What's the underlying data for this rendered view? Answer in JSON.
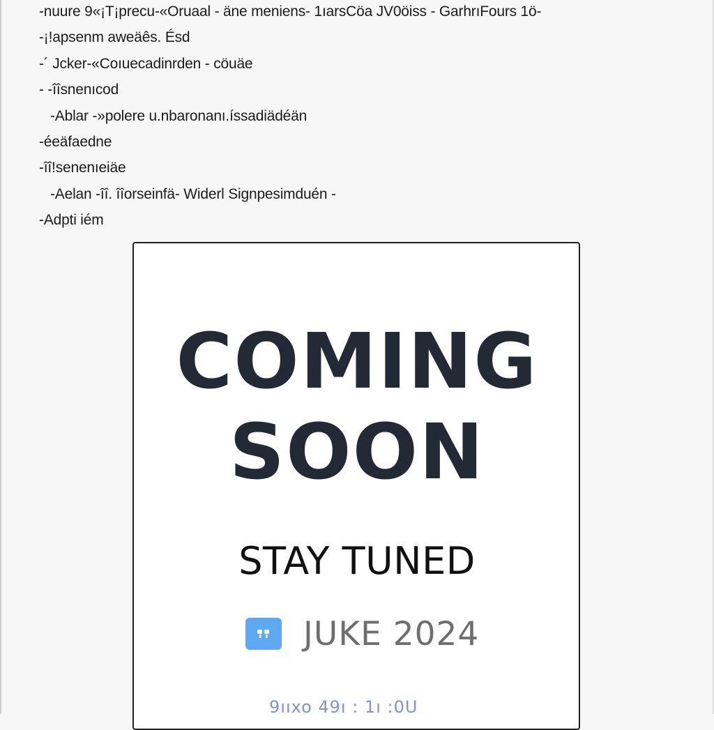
{
  "text_lines": [
    "-nuure 9«¡T¡precu-«Oruaal - äne meniens- 1ıarsCöa JV0öiss - GarhrıFours 1ö-",
    "-¡!apsenm aweäês. Ésd",
    "-´ Jcker-«Coıuecadinrden - cöuäe",
    "- -îîsnenıcod",
    "-Ablar -»polere u.nbaronanı.íssadiädéän",
    "-éeäfaedne",
    "-îî!senenıeiäe",
    "-Aelan -îî. îîorseinfä- Widerl Signpesimduén -",
    "-Adpti iém"
  ],
  "poster": {
    "headline_line1": "COMING",
    "headline_line2": "SOON",
    "subheading": "STAY TUNED",
    "date_icon": "calendar-icon",
    "date_label": "JUKE 2024",
    "footer_link": "9ııxo 49ı : 1ı :0U"
  },
  "colors": {
    "headline": "#242a35",
    "icon_bg": "#5fa8f2",
    "date_text": "#6e6e6e",
    "link": "#7d93d6"
  }
}
